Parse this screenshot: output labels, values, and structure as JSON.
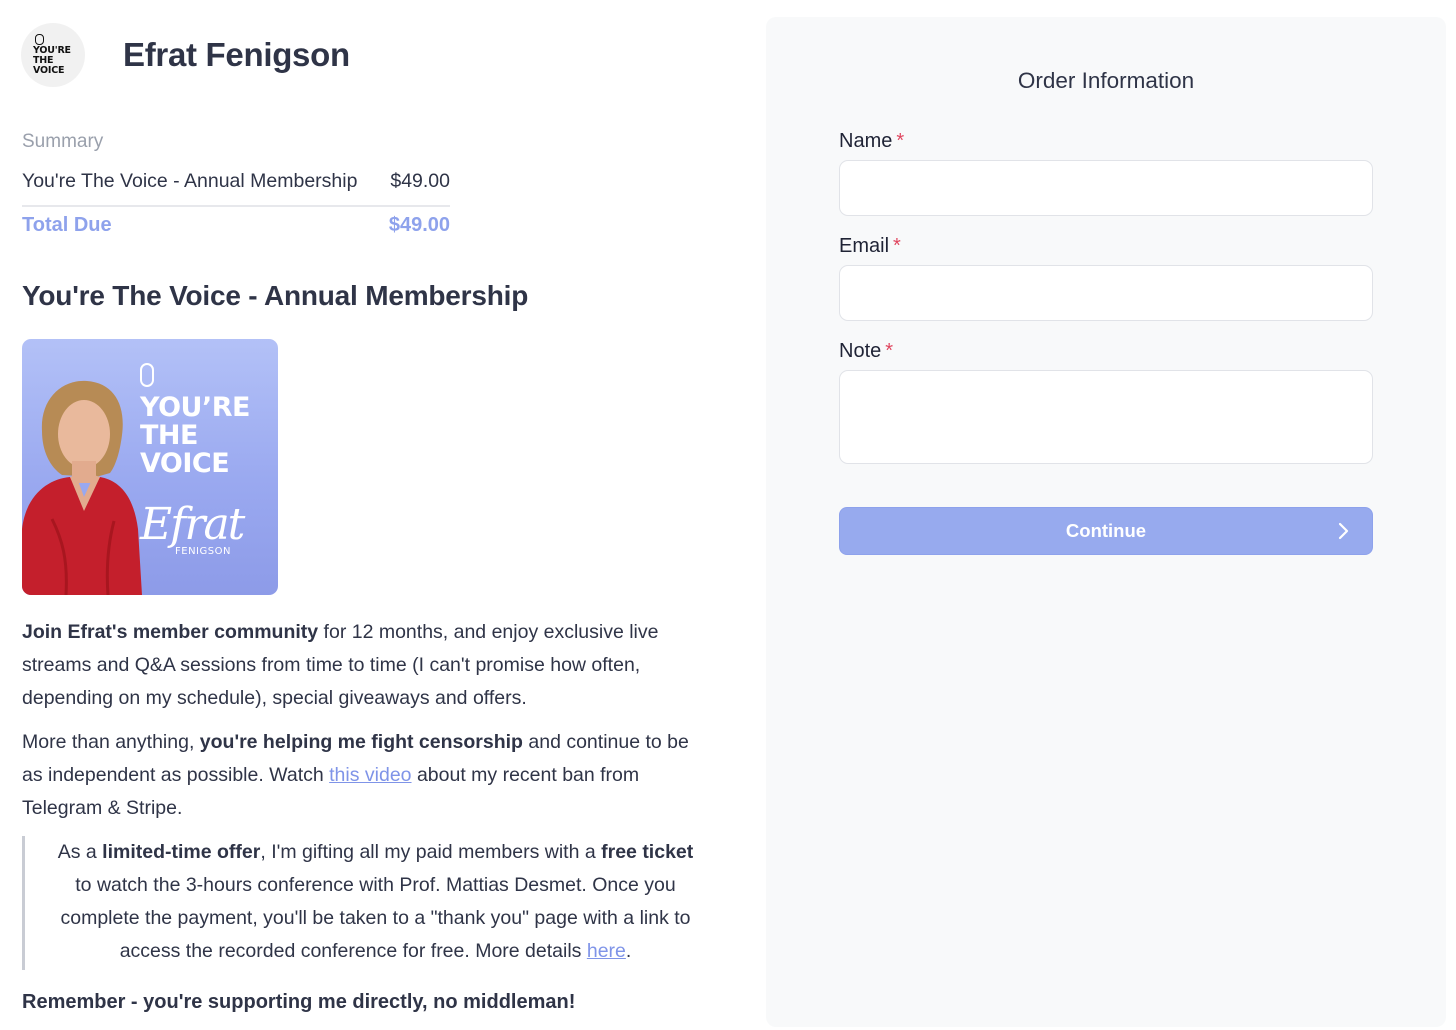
{
  "brand": {
    "logo_lines": [
      "YOU'RE",
      "THE",
      "VOICE"
    ],
    "name": "Efrat Fenigson"
  },
  "summary": {
    "label": "Summary",
    "item_name": "You're The Voice - Annual Membership",
    "item_price": "$49.00",
    "total_label": "Total Due",
    "total_price": "$49.00"
  },
  "product": {
    "title": "You're The Voice - Annual Membership",
    "image": {
      "lines": [
        "YOU’RE",
        "THE",
        "VOICE"
      ],
      "signature": "Efrat",
      "subtitle": "FENIGSON"
    },
    "p1": {
      "bold": "Join Efrat's member community",
      "text": " for 12 months, and enjoy exclusive live streams and Q&A sessions from time to time (I can't promise how often, depending on my schedule), special giveaways and offers."
    },
    "p2": {
      "pre": "More than anything, ",
      "bold": "you're helping me fight censorship",
      "mid": " and continue to be as independent as possible. Watch ",
      "link": "this video",
      "post": " about my recent ban from Telegram & Stripe."
    },
    "quote": {
      "t1": "As a ",
      "b1": "limited-time offer",
      "t2": ", I'm gifting all my paid members with a ",
      "b2": "free ticket",
      "t3": " to watch the 3-hours conference with Prof. Mattias Desmet. Once you complete the payment, you'll be taken to a \"thank you\" page with a link to access the recorded conference for free. More details ",
      "link": "here",
      "t4": "."
    },
    "remember": "Remember - you're supporting me directly, no middleman!"
  },
  "order_form": {
    "title": "Order Information",
    "required_marker": "*",
    "name_label": "Name",
    "name_value": "",
    "email_label": "Email",
    "email_value": "",
    "note_label": "Note",
    "note_value": "",
    "continue_label": "Continue"
  },
  "colors": {
    "accent": "#97aaee",
    "total_text": "#8ea2ec",
    "required": "#e0465f",
    "panel_bg": "#f8f9fa"
  }
}
